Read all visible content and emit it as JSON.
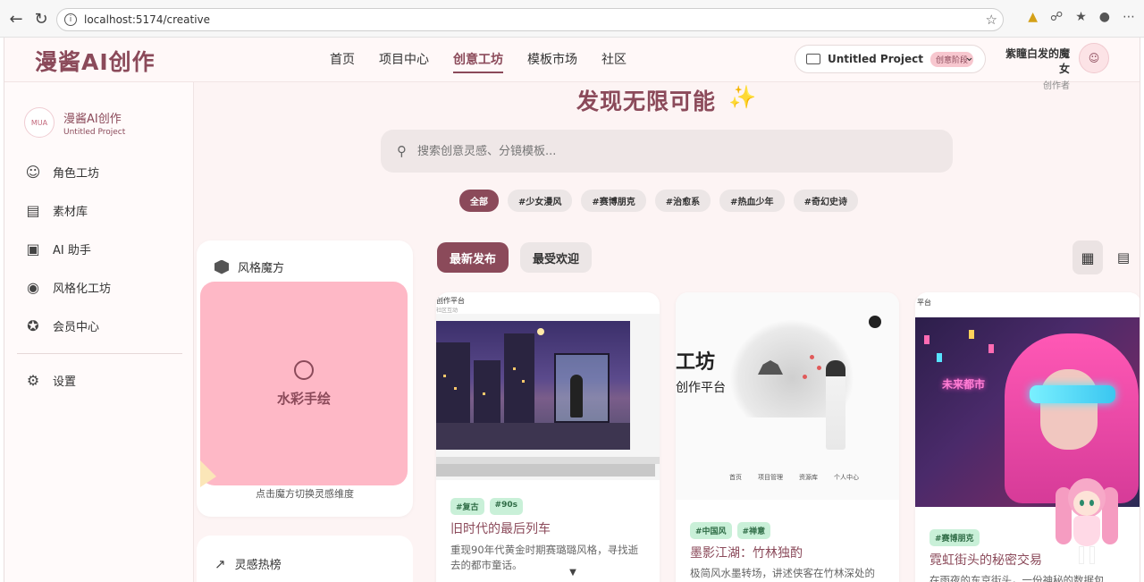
{
  "browser": {
    "url": "localhost:5174/creative",
    "back_icon": "back-arrow-icon",
    "reload_icon": "reload-icon"
  },
  "header": {
    "logo": "漫酱AI创作",
    "nav": [
      "首页",
      "项目中心",
      "创意工坊",
      "模板市场",
      "社区"
    ],
    "active_nav": "创意工坊",
    "project_name": "Untitled Project",
    "project_stage": "创意阶段",
    "user_name": "紫瞳白发的魔女",
    "user_role": "创作者"
  },
  "sidebar": {
    "brand_name": "漫酱AI创作",
    "brand_project": "Untitled Project",
    "brand_logo_text": "MUA",
    "items": [
      {
        "label": "角色工坊",
        "icon": "face-icon"
      },
      {
        "label": "素材库",
        "icon": "archive-icon"
      },
      {
        "label": "AI 助手",
        "icon": "robot-icon"
      },
      {
        "label": "风格化工坊",
        "icon": "palette-icon"
      },
      {
        "label": "会员中心",
        "icon": "star-circle-icon"
      }
    ],
    "settings_label": "设置"
  },
  "hero": {
    "title": "发现无限可能",
    "search_placeholder": "搜索创意灵感、分镜模板...",
    "tags": [
      "全部",
      "#少女漫风",
      "#赛博朋克",
      "#治愈系",
      "#热血少年",
      "#奇幻史诗"
    ],
    "active_tag": "全部"
  },
  "style_panel": {
    "title": "风格魔方",
    "style_name": "水彩手绘",
    "hint": "点击魔方切换灵感维度"
  },
  "trend_panel": {
    "title": "灵感热榜"
  },
  "feed": {
    "sort_latest": "最新发布",
    "sort_popular": "最受欢迎",
    "cards": [
      {
        "tags": [
          "#复古",
          "#90s"
        ],
        "title": "旧时代的最后列车",
        "desc": "重现90年代黄金时期赛璐璐风格，寻找逝去的都市童话。",
        "thumb_header": "创作平台",
        "thumb_sub": "社区互动"
      },
      {
        "tags": [
          "#中国风",
          "#禅意"
        ],
        "title": "墨影江湖：竹林独酌",
        "desc": "极简风水墨转场，讲述侠客在竹林深处的",
        "thumb_big": "工坊",
        "thumb_sub": "创作平台",
        "thumb_footer": [
          "首页",
          "项目管理",
          "资源库",
          "个人中心"
        ]
      },
      {
        "tags": [
          "#赛博朋克"
        ],
        "title": "霓虹街头的秘密交易",
        "desc": "在雨夜的东京街头，一份神秘的数据包",
        "thumb_header": "平台",
        "thumb_neon": "未来都市"
      }
    ]
  }
}
